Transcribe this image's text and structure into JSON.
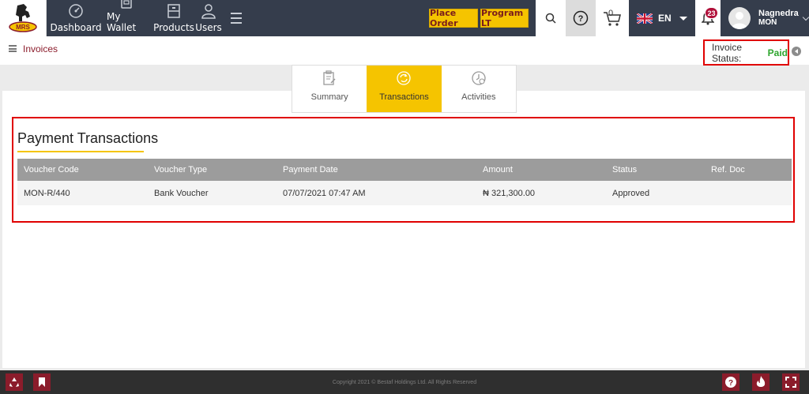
{
  "header": {
    "logo_text": "MRS",
    "nav": [
      {
        "label": "Dashboard",
        "icon": "dashboard-gauge-icon"
      },
      {
        "label": "My Wallet",
        "icon": "wallet-icon"
      },
      {
        "label": "Products",
        "icon": "products-box-icon"
      },
      {
        "label": "Users",
        "icon": "user-icon"
      }
    ],
    "place_order": "Place Order",
    "program_lt": "Program LT",
    "cart_count": "0",
    "language": "EN",
    "notification_count": "23",
    "user_name": "Nagnedra",
    "user_org": "MON"
  },
  "breadcrumb": "Invoices",
  "invoice_status": {
    "label": "Invoice Status:",
    "value": "Paid",
    "value_color": "#2ea52e"
  },
  "tabs": [
    {
      "label": "Summary",
      "active": false
    },
    {
      "label": "Transactions",
      "active": true
    },
    {
      "label": "Activities",
      "active": false
    }
  ],
  "section_title": "Payment Transactions",
  "table": {
    "columns": [
      "Voucher Code",
      "Voucher Type",
      "Payment Date",
      "Amount",
      "Status",
      "Ref. Doc"
    ],
    "rows": [
      [
        "MON-R/440",
        "Bank Voucher",
        "07/07/2021 07:47 AM",
        "₦ 321,300.00",
        "Approved",
        ""
      ]
    ]
  },
  "footer": {
    "copyright": "Copyright 2021 © Bestaf Holdings Ltd. All Rights Reserved"
  },
  "colors": {
    "nav_bg": "#353d4c",
    "accent_yellow": "#f5c400",
    "brand_red": "#8b1c2b",
    "highlight_red": "#e00000"
  }
}
